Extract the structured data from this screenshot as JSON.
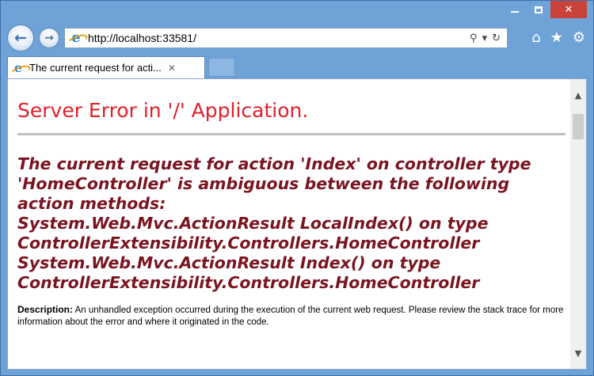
{
  "window": {
    "caption": {
      "minimize_icon": "minimize-icon",
      "maximize_icon": "maximize-icon",
      "close_icon": "close-icon",
      "close_glyph": "✕"
    }
  },
  "nav": {
    "back_glyph": "←",
    "forward_glyph": "→",
    "url": "http://localhost:33581/",
    "search_glyph": "⚲",
    "dropdown_glyph": "▾",
    "refresh_glyph": "↻",
    "home_glyph": "⌂",
    "favorites_glyph": "★",
    "tools_glyph": "⚙"
  },
  "tabs": [
    {
      "title": "The current request for acti...",
      "close_glyph": "✕"
    }
  ],
  "page": {
    "title": "Server Error in '/' Application.",
    "message": "The current request for action 'Index' on controller type\n'HomeController' is ambiguous between the following\naction methods:\nSystem.Web.Mvc.ActionResult LocalIndex() on type\nControllerExtensibility.Controllers.HomeController\nSystem.Web.Mvc.ActionResult Index() on type\nControllerExtensibility.Controllers.HomeController",
    "description_label": "Description:",
    "description_text": " An unhandled exception occurred during the execution of the current web request. Please review the stack trace for more information about the error and where it originated in the code."
  },
  "scrollbar": {
    "up_glyph": "▲",
    "down_glyph": "▼"
  },
  "colors": {
    "frame": "#6fa3d8",
    "close_button": "#c9433a",
    "error_title": "#e0202b",
    "error_message": "#7a1420"
  }
}
